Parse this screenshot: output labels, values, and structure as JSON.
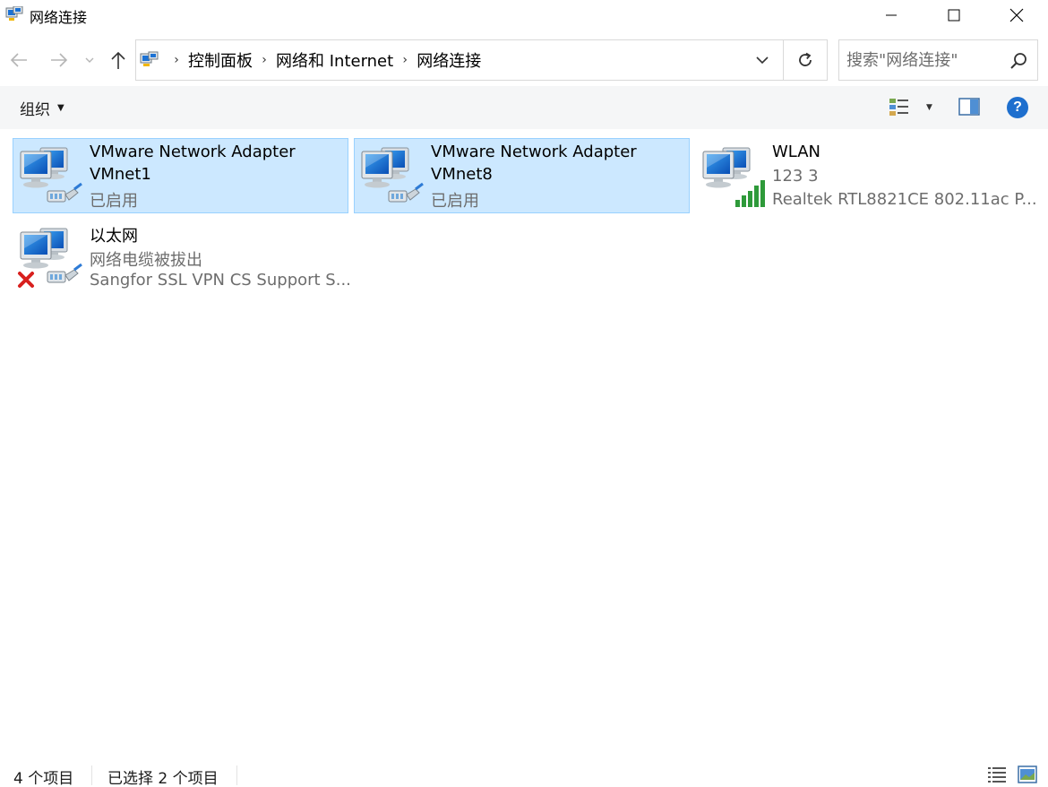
{
  "window": {
    "title": "网络连接",
    "controls": {
      "minimize": "minimize",
      "maximize": "maximize",
      "close": "close"
    }
  },
  "nav": {
    "back_icon": "arrow-left-icon",
    "forward_icon": "arrow-right-icon",
    "recent_icon": "chevron-down-icon",
    "up_icon": "arrow-up-icon"
  },
  "address": {
    "breadcrumbs": [
      "控制面板",
      "网络和 Internet",
      "网络连接"
    ],
    "refresh_icon": "refresh-icon"
  },
  "search": {
    "placeholder": "搜索\"网络连接\""
  },
  "toolbar": {
    "organize_label": "组织"
  },
  "items": [
    {
      "name": "VMware Network Adapter",
      "name2": "VMnet1",
      "status": "已启用",
      "selected": true,
      "icon": "network-adapter-icon"
    },
    {
      "name": "VMware Network Adapter",
      "name2": "VMnet8",
      "status": "已启用",
      "selected": true,
      "icon": "network-adapter-icon"
    },
    {
      "name": "WLAN",
      "status": "123 3",
      "device": "Realtek RTL8821CE 802.11ac P...",
      "selected": false,
      "icon": "wifi-adapter-icon"
    },
    {
      "name": "以太网",
      "status": "网络电缆被拔出",
      "device": "Sangfor SSL VPN CS Support S...",
      "selected": false,
      "icon": "ethernet-disconnected-icon"
    }
  ],
  "status": {
    "count": "4 个项目",
    "selected": "已选择 2 个项目"
  },
  "colors": {
    "selection_bg": "#cce8ff",
    "selection_border": "#99d1ff",
    "help_blue": "#1e6fce",
    "signal_green": "#2e9a3a",
    "error_red": "#d8201e"
  }
}
